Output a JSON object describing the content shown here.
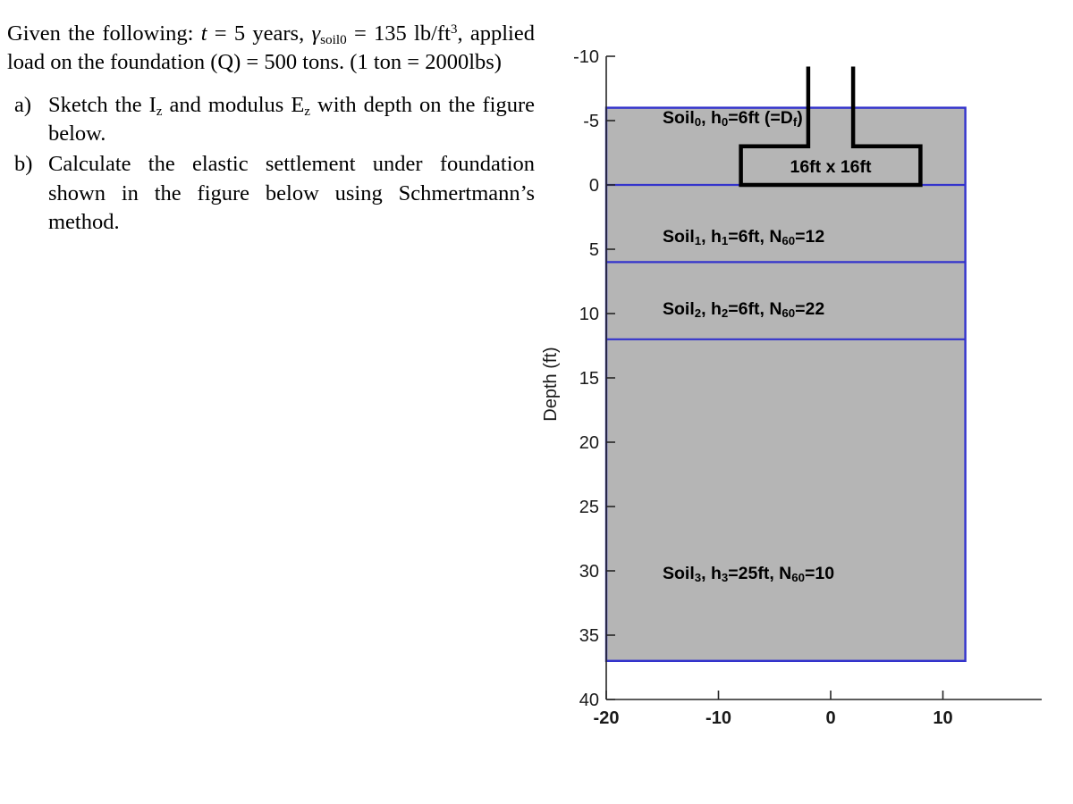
{
  "problem": {
    "given_prefix": "Given the following: ",
    "t_symbol": "t",
    "t_value": " = 5 years, ",
    "gamma_symbol": "γ",
    "gamma_sub": "soil0",
    "gamma_value": " =  135 lb/ft",
    "gamma_exp": "3",
    "load_text": ", applied load on the foundation (Q) = 500 tons. (1 ton = 2000lbs)",
    "items": [
      {
        "marker": "a)",
        "text_before": "Sketch the I",
        "sub1": "z",
        "text_mid": " and modulus E",
        "sub2": "z",
        "text_after": " with depth on the figure below."
      },
      {
        "marker": "b)",
        "text_before": "Calculate the elastic settlement under foundation shown in the figure below using Schmertmann’s method.",
        "sub1": "",
        "text_mid": "",
        "sub2": "",
        "text_after": ""
      }
    ]
  },
  "figure": {
    "y_axis_title": "Depth (ft)",
    "y_ticks": [
      "-10",
      "-5",
      "0",
      "5",
      "10",
      "15",
      "20",
      "25",
      "30",
      "35",
      "40"
    ],
    "y_tick_values": [
      -10,
      -5,
      0,
      5,
      10,
      15,
      20,
      25,
      30,
      35,
      40
    ],
    "x_ticks": [
      "-20",
      "-10",
      "0",
      "10"
    ],
    "x_tick_values": [
      -20,
      -10,
      0,
      10
    ],
    "foundation_label": "16ft x 16ft",
    "soil_layers": [
      {
        "name": "Soil",
        "name_sub": "0",
        "mid": ", h",
        "h_sub": "0",
        "h_text": "=6ft (=D",
        "n_sub": "f",
        "tail": ")",
        "depth_top": -6,
        "depth_bottom": 0
      },
      {
        "name": "Soil",
        "name_sub": "1",
        "mid": ", h",
        "h_sub": "1",
        "h_text": "=6ft, N",
        "n_sub": "60",
        "tail": "=12",
        "depth_top": 0,
        "depth_bottom": 6
      },
      {
        "name": "Soil",
        "name_sub": "2",
        "mid": ", h",
        "h_sub": "2",
        "h_text": "=6ft, N",
        "n_sub": "60",
        "tail": "=22",
        "depth_top": 6,
        "depth_bottom": 12
      },
      {
        "name": "Soil",
        "name_sub": "3",
        "mid": ", h",
        "h_sub": "3",
        "h_text": "=25ft, N",
        "n_sub": "60",
        "tail": "=10",
        "depth_top": 12,
        "depth_bottom": 37
      }
    ],
    "colors": {
      "soil_fill": "#b5b5b5",
      "layer_border": "#3333cc",
      "foundation_line": "#000000",
      "axis": "#262626"
    }
  },
  "chart_data": {
    "type": "diagram",
    "title": "Soil profile with square foundation",
    "xlabel": "",
    "ylabel": "Depth (ft)",
    "ylim": [
      -10,
      40
    ],
    "xlim": [
      -22.5,
      15.9
    ],
    "y_inverted": true,
    "grid": false,
    "legend": "none",
    "soil_block": {
      "x_left": -20,
      "x_right": 12,
      "depth_top": -6,
      "depth_bottom": 37
    },
    "layer_boundaries_depth_ft": [
      -6,
      0,
      6,
      12,
      37
    ],
    "layers": [
      {
        "label": "Soil0",
        "h_ft": 6,
        "top_ft": -6,
        "bottom_ft": 0,
        "N60": null,
        "note": "h0=6ft (=Df)"
      },
      {
        "label": "Soil1",
        "h_ft": 6,
        "top_ft": 0,
        "bottom_ft": 6,
        "N60": 12
      },
      {
        "label": "Soil2",
        "h_ft": 6,
        "top_ft": 6,
        "bottom_ft": 12,
        "N60": 22
      },
      {
        "label": "Soil3",
        "h_ft": 25,
        "top_ft": 12,
        "bottom_ft": 37,
        "N60": 10
      }
    ],
    "foundation": {
      "footing_width_ft": 16,
      "footing_length_ft": 16,
      "footing_top_ft": -3.0,
      "footing_bottom_ft": 0,
      "column_width_ft": 4,
      "column_top_ft": -9.2,
      "label": "16ft x 16ft"
    },
    "given": {
      "t_years": 5,
      "gamma_soil0_pcf": 135,
      "Q_tons": 500,
      "ton_to_lbs": 2000
    }
  }
}
